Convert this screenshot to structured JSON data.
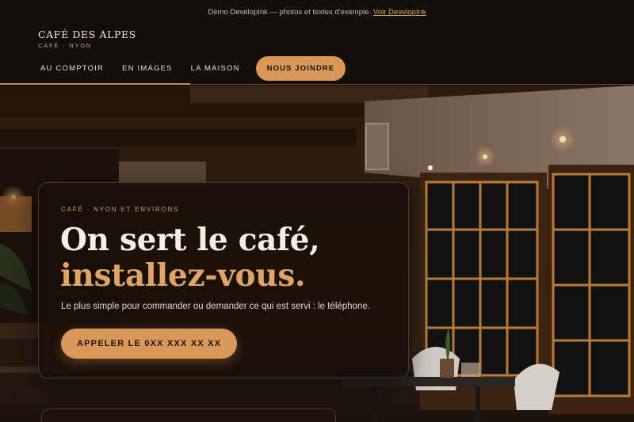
{
  "topbar": {
    "text": "Démo DevelopInk — photos et textes d'exemple.",
    "link": "Voir DevelopInk"
  },
  "brand": {
    "name": "CAFÉ DES ALPES",
    "subtitle": "CAFÉ · NYON"
  },
  "nav": {
    "items": [
      {
        "label": "AU COMPTOIR"
      },
      {
        "label": "EN IMAGES"
      },
      {
        "label": "LA MAISON"
      }
    ],
    "cta": "NOUS JOINDRE"
  },
  "hero": {
    "eyebrow": "CAFÉ · NYON ET ENVIRONS",
    "headline_line1": "On sert le café,",
    "headline_line2": "installez-vous.",
    "lead": "Le plus simple pour commander ou demander ce qui est servi : le téléphone.",
    "cta": "APPELER LE 0XX XXX XX XX"
  },
  "colors": {
    "background": "#140e0a",
    "accent": "#d9985a",
    "accent_text": "#e0a566",
    "text": "#f3ebe2"
  }
}
